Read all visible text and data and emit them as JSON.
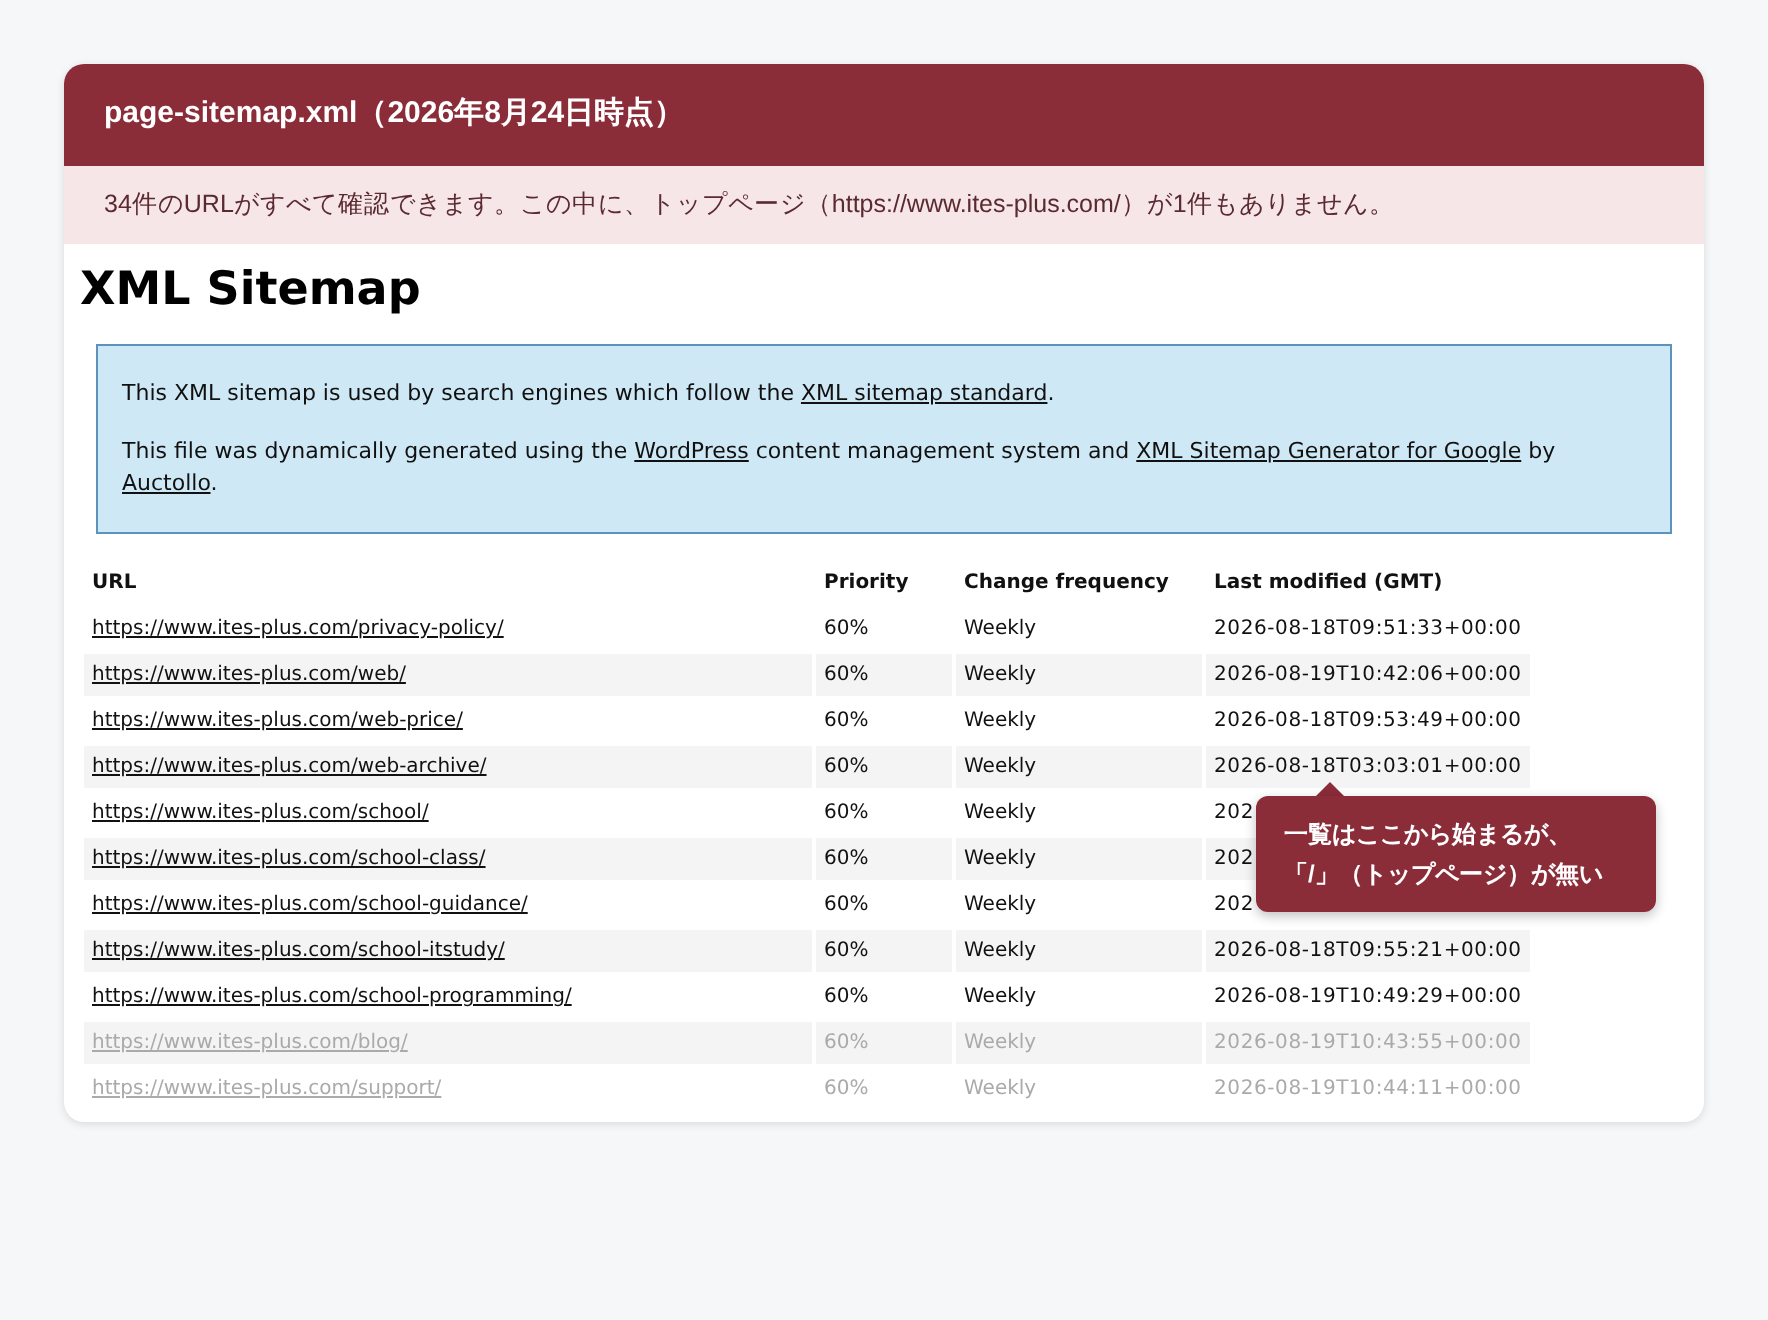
{
  "header": {
    "title": "page-sitemap.xml（2026年8月24日時点）",
    "note": "34件のURLがすべて確認できます。この中に、トップページ（https://www.ites-plus.com/）が1件もありません。"
  },
  "sitemap": {
    "heading": "XML Sitemap",
    "info": [
      [
        {
          "text": "This XML sitemap is used by search engines which follow the ",
          "link": false
        },
        {
          "text": "XML sitemap standard",
          "link": true
        },
        {
          "text": ".",
          "link": false
        }
      ],
      [
        {
          "text": "This file was dynamically generated using the ",
          "link": false
        },
        {
          "text": "WordPress",
          "link": true
        },
        {
          "text": " content management system and ",
          "link": false
        },
        {
          "text": "XML Sitemap Generator for Google",
          "link": true
        },
        {
          "text": " by ",
          "link": false
        },
        {
          "text": "Auctollo",
          "link": true
        },
        {
          "text": ".",
          "link": false
        }
      ]
    ],
    "columns": [
      "URL",
      "Priority",
      "Change frequency",
      "Last modified (GMT)"
    ],
    "rows": [
      {
        "url": "https://www.ites-plus.com/privacy-policy/",
        "priority": "60%",
        "frequency": "Weekly",
        "modified": "2026-08-18T09:51:33+00:00",
        "faded": false
      },
      {
        "url": "https://www.ites-plus.com/web/",
        "priority": "60%",
        "frequency": "Weekly",
        "modified": "2026-08-19T10:42:06+00:00",
        "faded": false
      },
      {
        "url": "https://www.ites-plus.com/web-price/",
        "priority": "60%",
        "frequency": "Weekly",
        "modified": "2026-08-18T09:53:49+00:00",
        "faded": false
      },
      {
        "url": "https://www.ites-plus.com/web-archive/",
        "priority": "60%",
        "frequency": "Weekly",
        "modified": "2026-08-18T03:03:01+00:00",
        "faded": false
      },
      {
        "url": "https://www.ites-plus.com/school/",
        "priority": "60%",
        "frequency": "Weekly",
        "modified": "202",
        "faded": false
      },
      {
        "url": "https://www.ites-plus.com/school-class/",
        "priority": "60%",
        "frequency": "Weekly",
        "modified": "202",
        "faded": false
      },
      {
        "url": "https://www.ites-plus.com/school-guidance/",
        "priority": "60%",
        "frequency": "Weekly",
        "modified": "202",
        "faded": false
      },
      {
        "url": "https://www.ites-plus.com/school-itstudy/",
        "priority": "60%",
        "frequency": "Weekly",
        "modified": "2026-08-18T09:55:21+00:00",
        "faded": false
      },
      {
        "url": "https://www.ites-plus.com/school-programming/",
        "priority": "60%",
        "frequency": "Weekly",
        "modified": "2026-08-19T10:49:29+00:00",
        "faded": false
      },
      {
        "url": "https://www.ites-plus.com/blog/",
        "priority": "60%",
        "frequency": "Weekly",
        "modified": "2026-08-19T10:43:55+00:00",
        "faded": true
      },
      {
        "url": "https://www.ites-plus.com/support/",
        "priority": "60%",
        "frequency": "Weekly",
        "modified": "2026-08-19T10:44:11+00:00",
        "faded": true
      }
    ]
  },
  "callout": {
    "lines": [
      "一覧はここから始まるが、",
      "「/」（トップページ）が無い"
    ]
  }
}
